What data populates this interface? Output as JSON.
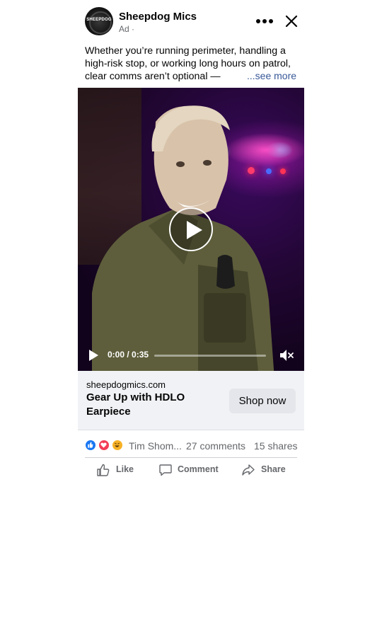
{
  "header": {
    "avatar_text": "SHEEPDOG",
    "page_name": "Sheepdog Mics",
    "ad_label": "Ad ·",
    "more_icon": "more-horizontal-icon",
    "close_icon": "close-icon"
  },
  "caption": {
    "text": "Whether you’re running perimeter, handling a high-risk stop, or working long hours on patrol, clear comms aren’t optional —",
    "see_more": "...see more"
  },
  "video": {
    "play_icon": "play-icon",
    "current_time": "0:00",
    "duration": "0:35",
    "time_display": "0:00 / 0:35",
    "progress_fraction": 0,
    "mute_icon": "volume-muted-icon"
  },
  "cta": {
    "domain": "sheepdogmics.com",
    "headline": "Gear Up with HDLO Earpiece",
    "button_label": "Shop now"
  },
  "engagement": {
    "reactions": [
      "like",
      "love",
      "haha"
    ],
    "reactors": "Tim Shom...",
    "comments": "27 comments",
    "shares": "15 shares"
  },
  "actions": [
    {
      "label": "Like",
      "icon": "thumbs-up-icon"
    },
    {
      "label": "Comment",
      "icon": "comment-icon"
    },
    {
      "label": "Share",
      "icon": "share-icon"
    }
  ],
  "colors": {
    "link": "#385898",
    "secondary_text": "#65676b",
    "cta_background": "#f0f2f5",
    "like": "#1877f2",
    "love": "#f33e58",
    "haha": "#f7b125"
  }
}
